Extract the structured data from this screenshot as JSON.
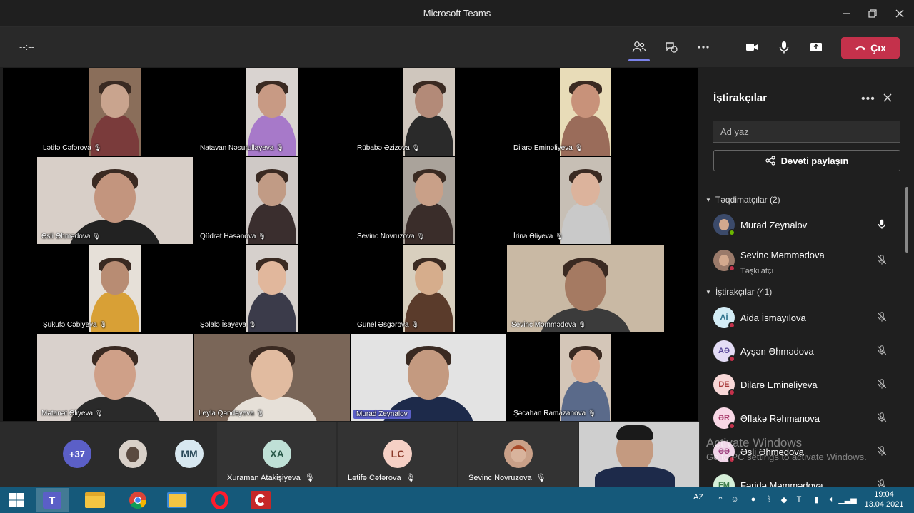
{
  "window": {
    "title": "Microsoft Teams"
  },
  "toolbar": {
    "timer": "--:--",
    "leave_label": "Çıx"
  },
  "tiles": [
    {
      "name": "Lətifə Cəfərova",
      "bg": "#8a6e5a",
      "face": "#c9a48e",
      "cloth": "#7a3b3b"
    },
    {
      "name": "Natavan Nəsurullayeva",
      "bg": "#d9d3d0",
      "face": "#c89a84",
      "cloth": "#a779c9"
    },
    {
      "name": "Rübabə Əzizova",
      "bg": "#cfc6bd",
      "face": "#b38a78",
      "cloth": "#2a2a2a"
    },
    {
      "name": "Dilarə Eminəliyeva",
      "bg": "#e8dcb8",
      "face": "#c8927a",
      "cloth": "#9a6c5a"
    },
    {
      "name": "Əsli Əhmədova",
      "bg": "#d8cfc8",
      "face": "#c3957e",
      "cloth": "#222222"
    },
    {
      "name": "Qüdrət Həsənova",
      "bg": "#cfc9c6",
      "face": "#c19b85",
      "cloth": "#3a2e2e"
    },
    {
      "name": "Sevinc Novruzova",
      "bg": "#aaa39b",
      "face": "#c9a088",
      "cloth": "#3a2d2a"
    },
    {
      "name": "İrina Əliyeva",
      "bg": "#c7bfb5",
      "face": "#dcb39c",
      "cloth": "#c9c9c9"
    },
    {
      "name": "Şükufə Cəbiyeva",
      "bg": "#e6e0d8",
      "face": "#b88c73",
      "cloth": "#d8a036"
    },
    {
      "name": "Şəlalə İsayeva",
      "bg": "#d6d0cc",
      "face": "#e1b79c",
      "cloth": "#3b3b4a"
    },
    {
      "name": "Günel Əsgərova",
      "bg": "#d8cfbe",
      "face": "#d6ad8c",
      "cloth": "#5a3b2b"
    },
    {
      "name": "Sevinc Məmmədova",
      "bg": "#c9b9a4",
      "face": "#a57a62",
      "cloth": "#3b3b3b"
    },
    {
      "name": "Mətanət Əliyeva",
      "bg": "#d9d1cc",
      "face": "#cfa088",
      "cloth": "#2a2a2a"
    },
    {
      "name": "Leyla Qəndəyeva",
      "bg": "#7a6658",
      "face": "#e1bba0",
      "cloth": "#e6e0d8"
    },
    {
      "name": "Murad Zeynalov",
      "bg": "#e3e3e3",
      "face": "#c49a80",
      "cloth": "#1d2a4a"
    },
    {
      "name": "Şəcahan Ramazanova",
      "bg": "#d4c6b8",
      "face": "#d8ab92",
      "cloth": "#5a6a8a"
    }
  ],
  "strip": {
    "more_count": "+37",
    "mm_initials": "MM",
    "cells": [
      {
        "initials": "XA",
        "name": "Xuraman Atakişiyeva",
        "color": "#bfe0d6"
      },
      {
        "initials": "LC",
        "name": "Lətifə Cəfərova",
        "color": "#f5d0c5"
      },
      {
        "initials": "",
        "name": "Sevinc Novruzova",
        "color": "#c9a088"
      }
    ]
  },
  "panel": {
    "title": "İştirakçılar",
    "search_placeholder": "Ad yaz",
    "share_label": "Dəvəti paylaşın",
    "presenters_header": "Təqdimatçılar (2)",
    "attendees_header": "İştirakçılar (41)",
    "presenters": [
      {
        "name": "Murad Zeynalov",
        "role": "",
        "initials": "",
        "color": "#3b4a6a",
        "dot": "#6bb700",
        "mic": "on"
      },
      {
        "name": "Sevinc Məmmədova",
        "role": "Təşkilatçı",
        "initials": "",
        "color": "#9a7a6a",
        "dot": "#c4314b",
        "mic": "off"
      }
    ],
    "attendees": [
      {
        "name": "Aida İsmayılova",
        "initials": "Aİ",
        "color": "#d3ecf5",
        "tc": "#2a6f8a"
      },
      {
        "name": "Ayşən Əhmədova",
        "initials": "AƏ",
        "color": "#e3dcf5",
        "tc": "#5a4a9a"
      },
      {
        "name": "Dilarə Eminəliyeva",
        "initials": "DE",
        "color": "#f8d8d8",
        "tc": "#a83a3a"
      },
      {
        "name": "Əflakə Rəhmanova",
        "initials": "ƏR",
        "color": "#f8d8e6",
        "tc": "#a83a6a"
      },
      {
        "name": "Əsli Əhmədova",
        "initials": "ƏƏ",
        "color": "#f0d5e8",
        "tc": "#9a3a7a"
      },
      {
        "name": "Fəridə Məmmədova",
        "initials": "FM",
        "color": "#d5efd8",
        "tc": "#3a7a4a"
      }
    ]
  },
  "watermark": {
    "line1": "Activate Windows",
    "line2": "Go to PC settings to activate Windows."
  },
  "taskbar": {
    "lang": "AZ",
    "time": "19:04",
    "date": "13.04.2021"
  }
}
